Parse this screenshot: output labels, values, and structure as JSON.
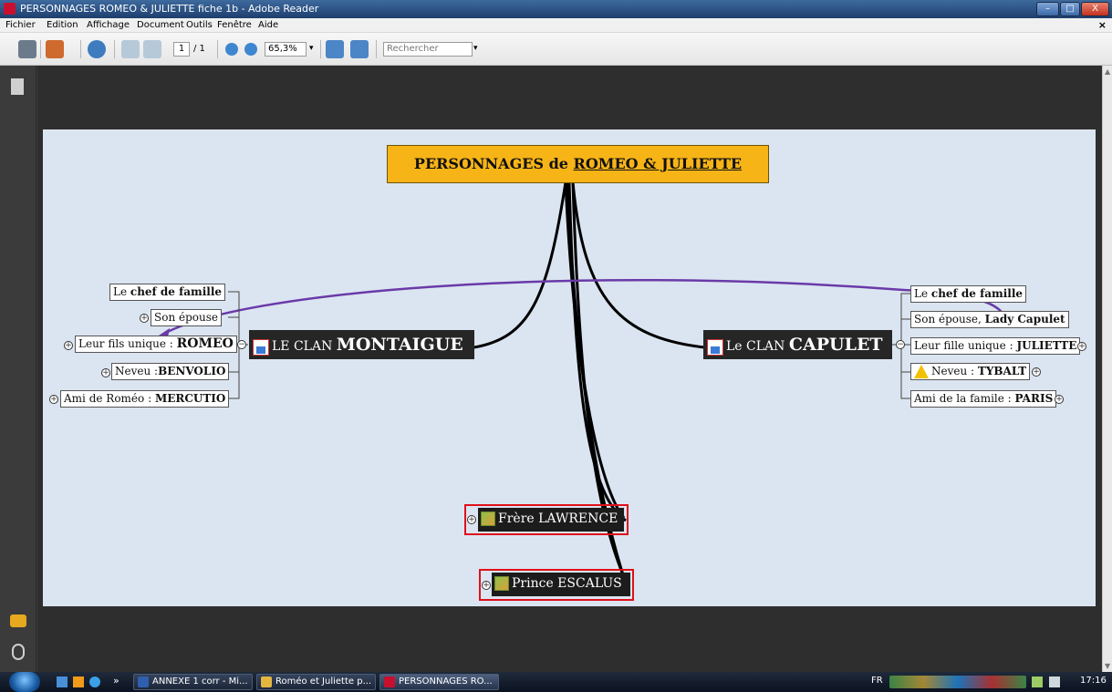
{
  "window": {
    "title": "PERSONNAGES ROMEO & JULIETTE fiche 1b - Adobe Reader",
    "minimize": "–",
    "maximize": "□",
    "close": "X"
  },
  "menu": [
    "Fichier",
    "Edition",
    "Affichage",
    "Document",
    "Outils",
    "Fenêtre",
    "Aide"
  ],
  "menu_close": "×",
  "toolbar": {
    "page_current": "1",
    "page_total": "/ 1",
    "zoom": "65,3%",
    "search_placeholder": "Rechercher"
  },
  "mindmap": {
    "central_prefix": "PERSONNAGES de ",
    "central_underlined": "ROMEO & JULIETTE",
    "montaigue": {
      "prefix": "LE CLAN ",
      "name": "MONTAIGUE"
    },
    "capulet": {
      "prefix": "Le CLAN ",
      "name": "CAPULET"
    },
    "montaigue_children": [
      {
        "prefix": "Le ",
        "bold": "chef de famille"
      },
      {
        "prefix": "Son épouse",
        "bold": ""
      },
      {
        "prefix": "Leur fils unique : ",
        "bold": "ROMEO"
      },
      {
        "prefix": "Neveu :",
        "bold": "BENVOLIO"
      },
      {
        "prefix": "Ami de Roméo : ",
        "bold": "MERCUTIO"
      }
    ],
    "capulet_children": [
      {
        "prefix": "Le ",
        "bold": "chef de famille"
      },
      {
        "prefix": "Son épouse, ",
        "bold": "Lady Capulet"
      },
      {
        "prefix": "Leur fille unique : ",
        "bold": "JULIETTE"
      },
      {
        "prefix": "Neveu : ",
        "bold": "TYBALT"
      },
      {
        "prefix": "Ami de la famile : ",
        "bold": "PARIS"
      }
    ],
    "lawrence": "Frère LAWRENCE",
    "escalus": "Prince ESCALUS"
  },
  "colors": {
    "central": "#f7b417",
    "page": "#dbe5f1",
    "link": "#6a3aa8",
    "highlight": "#e0101a"
  },
  "taskbar": {
    "items": [
      "ANNEXE 1 corr - Mi...",
      "Roméo et Juliette p...",
      "PERSONNAGES RO..."
    ],
    "lang": "FR",
    "clock": "17:16",
    "chevron": "»"
  }
}
